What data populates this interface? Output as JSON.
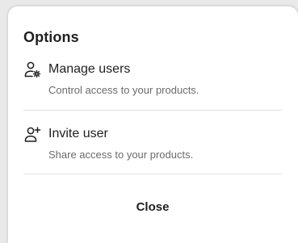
{
  "dialog": {
    "title": "Options",
    "options": [
      {
        "icon": "user-gear-icon",
        "label": "Manage users",
        "description": "Control access to your products."
      },
      {
        "icon": "user-plus-icon",
        "label": "Invite user",
        "description": "Share access to your products."
      }
    ],
    "close_label": "Close"
  },
  "colors": {
    "text_primary": "#1f1f1f",
    "text_secondary": "#6b6b6b",
    "divider": "#e3e3e3",
    "background": "#ffffff"
  }
}
